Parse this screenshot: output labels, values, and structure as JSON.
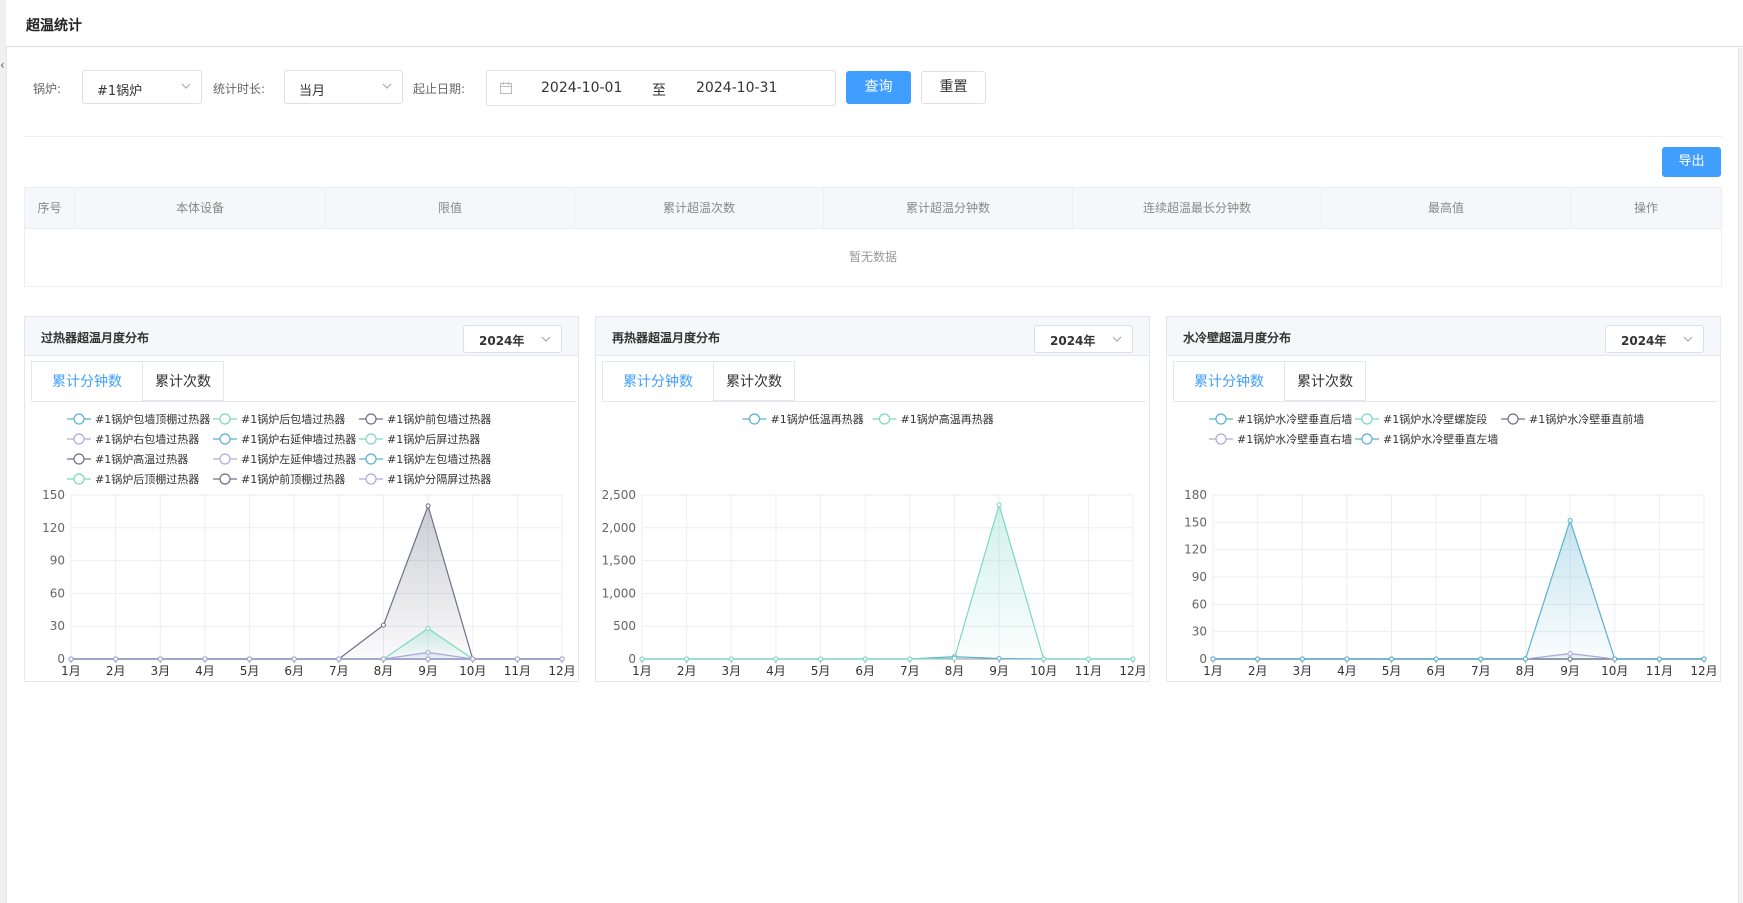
{
  "page": {
    "title": "超温统计"
  },
  "filters": {
    "boiler_label": "锅炉:",
    "boiler_value": "#1锅炉",
    "duration_label": "统计时长:",
    "duration_value": "当月",
    "date_label": "起止日期:",
    "date_start": "2024-10-01",
    "date_separator": "至",
    "date_end": "2024-10-31",
    "query_button": "查询",
    "reset_button": "重置"
  },
  "toolbar": {
    "export_button": "导出"
  },
  "table": {
    "columns": [
      "序号",
      "本体设备",
      "限值",
      "累计超温次数",
      "累计超温分钟数",
      "连续超温最长分钟数",
      "最高值",
      "操作"
    ],
    "empty_text": "暂无数据"
  },
  "panels": [
    {
      "title": "过热器超温月度分布",
      "year": "2024年",
      "tabs": [
        "累计分钟数",
        "累计次数"
      ],
      "active_tab": 0,
      "chart_data": {
        "type": "line",
        "categories": [
          "1月",
          "2月",
          "3月",
          "4月",
          "5月",
          "6月",
          "7月",
          "8月",
          "9月",
          "10月",
          "11月",
          "12月"
        ],
        "ylim": [
          0,
          150
        ],
        "yticks": [
          "0",
          "30",
          "60",
          "90",
          "120",
          "150"
        ],
        "legend_position": "top",
        "series": [
          {
            "name": "#1锅炉包墙顶棚过热器",
            "color": "#5ab1d0",
            "values": [
              0,
              0,
              0,
              0,
              0,
              0,
              0,
              0,
              0,
              0,
              0,
              0
            ]
          },
          {
            "name": "#1锅炉后包墙过热器",
            "color": "#7ed8c0",
            "values": [
              0,
              0,
              0,
              0,
              0,
              0,
              0,
              0,
              0,
              0,
              0,
              0
            ]
          },
          {
            "name": "#1锅炉前包墙过热器",
            "color": "#6e7085",
            "values": [
              0,
              0,
              0,
              0,
              0,
              0,
              0,
              0,
              0,
              0,
              0,
              0
            ]
          },
          {
            "name": "#1锅炉右包墙过热器",
            "color": "#b3a8d8",
            "values": [
              0,
              0,
              0,
              0,
              0,
              0,
              0,
              0,
              6,
              0,
              0,
              0
            ]
          },
          {
            "name": "#1锅炉右延伸墙过热器",
            "color": "#5ab1d0",
            "values": [
              0,
              0,
              0,
              0,
              0,
              0,
              0,
              0,
              0,
              0,
              0,
              0
            ]
          },
          {
            "name": "#1锅炉后屏过热器",
            "color": "#7ed8c0",
            "values": [
              0,
              0,
              0,
              0,
              0,
              0,
              0,
              0,
              0,
              0,
              0,
              0
            ]
          },
          {
            "name": "#1锅炉高温过热器",
            "color": "#6e7085",
            "values": [
              0,
              0,
              0,
              0,
              0,
              0,
              0,
              31,
              140,
              0,
              0,
              0
            ]
          },
          {
            "name": "#1锅炉左延伸墙过热器",
            "color": "#b3a8d8",
            "values": [
              0,
              0,
              0,
              0,
              0,
              0,
              0,
              0,
              0,
              0,
              0,
              0
            ]
          },
          {
            "name": "#1锅炉左包墙过热器",
            "color": "#5ab1d0",
            "values": [
              0,
              0,
              0,
              0,
              0,
              0,
              0,
              0,
              0,
              0,
              0,
              0
            ]
          },
          {
            "name": "#1锅炉后顶棚过热器",
            "color": "#7ed8c0",
            "values": [
              0,
              0,
              0,
              0,
              0,
              0,
              0,
              0,
              28,
              0,
              0,
              0
            ]
          },
          {
            "name": "#1锅炉前顶棚过热器",
            "color": "#6e7085",
            "values": [
              0,
              0,
              0,
              0,
              0,
              0,
              0,
              0,
              0,
              0,
              0,
              0
            ]
          },
          {
            "name": "#1锅炉分隔屏过热器",
            "color": "#b3a8d8",
            "values": [
              0,
              0,
              0,
              0,
              0,
              0,
              0,
              0,
              0,
              0,
              0,
              0
            ]
          }
        ]
      }
    },
    {
      "title": "再热器超温月度分布",
      "year": "2024年",
      "tabs": [
        "累计分钟数",
        "累计次数"
      ],
      "active_tab": 0,
      "chart_data": {
        "type": "line",
        "categories": [
          "1月",
          "2月",
          "3月",
          "4月",
          "5月",
          "6月",
          "7月",
          "8月",
          "9月",
          "10月",
          "11月",
          "12月"
        ],
        "ylim": [
          0,
          2500
        ],
        "yticks": [
          "0",
          "500",
          "1,000",
          "1,500",
          "2,000",
          "2,500"
        ],
        "legend_position": "top",
        "series": [
          {
            "name": "#1锅炉低温再热器",
            "color": "#5ab1d0",
            "values": [
              0,
              0,
              0,
              0,
              0,
              0,
              0,
              35,
              8,
              0,
              0,
              0
            ]
          },
          {
            "name": "#1锅炉高温再热器",
            "color": "#7ed8c0",
            "values": [
              0,
              0,
              0,
              0,
              0,
              0,
              0,
              10,
              2350,
              0,
              0,
              0
            ]
          }
        ]
      }
    },
    {
      "title": "水冷壁超温月度分布",
      "year": "2024年",
      "tabs": [
        "累计分钟数",
        "累计次数"
      ],
      "active_tab": 0,
      "chart_data": {
        "type": "line",
        "categories": [
          "1月",
          "2月",
          "3月",
          "4月",
          "5月",
          "6月",
          "7月",
          "8月",
          "9月",
          "10月",
          "11月",
          "12月"
        ],
        "ylim": [
          0,
          180
        ],
        "yticks": [
          "0",
          "30",
          "60",
          "90",
          "120",
          "150",
          "180"
        ],
        "legend_position": "top",
        "series": [
          {
            "name": "#1锅炉水冷壁垂直后墙",
            "color": "#5ab1d0",
            "values": [
              0,
              0,
              0,
              0,
              0,
              0,
              0,
              0,
              0,
              0,
              0,
              0
            ]
          },
          {
            "name": "#1锅炉水冷壁螺旋段",
            "color": "#7ed8c0",
            "values": [
              0,
              0,
              0,
              0,
              0,
              0,
              0,
              0,
              0,
              0,
              0,
              0
            ]
          },
          {
            "name": "#1锅炉水冷壁垂直前墙",
            "color": "#6e7085",
            "values": [
              0,
              0,
              0,
              0,
              0,
              0,
              0,
              0,
              0,
              0,
              0,
              0
            ]
          },
          {
            "name": "#1锅炉水冷壁垂直右墙",
            "color": "#b3a8d8",
            "values": [
              0,
              0,
              0,
              0,
              0,
              0,
              0,
              0,
              6,
              0,
              0,
              0
            ]
          },
          {
            "name": "#1锅炉水冷壁垂直左墙",
            "color": "#5ab1d0",
            "values": [
              0,
              0,
              0,
              0,
              0,
              0,
              0,
              0,
              152,
              0,
              0,
              0
            ]
          }
        ]
      }
    }
  ]
}
